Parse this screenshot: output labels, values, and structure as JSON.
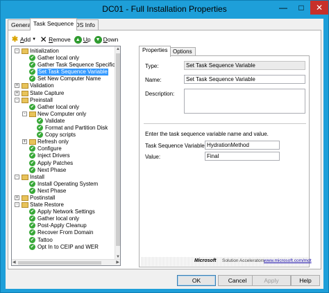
{
  "window": {
    "title": "DC01 - Full Installation Properties",
    "min": "—",
    "max": "□",
    "close": "✕"
  },
  "outer_tabs": [
    "General",
    "Task Sequence",
    "OS Info"
  ],
  "toolbar": {
    "add": "Add",
    "remove": "Remove",
    "up": "Up",
    "down": "Down"
  },
  "tree": [
    {
      "label": "Initialization",
      "level": 0,
      "type": "folder",
      "exp": "-"
    },
    {
      "label": "Gather local only",
      "level": 1,
      "type": "check"
    },
    {
      "label": "Gather Task Sequence Specific Settin",
      "level": 1,
      "type": "check"
    },
    {
      "label": "Set Task Sequence Variable",
      "level": 1,
      "type": "check",
      "selected": true
    },
    {
      "label": "Set New Computer Name",
      "level": 1,
      "type": "check"
    },
    {
      "label": "Validation",
      "level": 0,
      "type": "folder",
      "exp": "+"
    },
    {
      "label": "State Capture",
      "level": 0,
      "type": "folder",
      "exp": "+"
    },
    {
      "label": "Preinstall",
      "level": 0,
      "type": "folder",
      "exp": "-"
    },
    {
      "label": "Gather local only",
      "level": 1,
      "type": "check"
    },
    {
      "label": "New Computer only",
      "level": 1,
      "type": "folder",
      "exp": "-"
    },
    {
      "label": "Validate",
      "level": 2,
      "type": "check"
    },
    {
      "label": "Format and Partition Disk",
      "level": 2,
      "type": "check"
    },
    {
      "label": "Copy scripts",
      "level": 2,
      "type": "check"
    },
    {
      "label": "Refresh only",
      "level": 1,
      "type": "folder",
      "exp": "+"
    },
    {
      "label": "Configure",
      "level": 1,
      "type": "check"
    },
    {
      "label": "Inject Drivers",
      "level": 1,
      "type": "check"
    },
    {
      "label": "Apply Patches",
      "level": 1,
      "type": "check"
    },
    {
      "label": "Next Phase",
      "level": 1,
      "type": "check"
    },
    {
      "label": "Install",
      "level": 0,
      "type": "folder",
      "exp": "-"
    },
    {
      "label": "Install Operating System",
      "level": 1,
      "type": "check"
    },
    {
      "label": "Next Phase",
      "level": 1,
      "type": "check"
    },
    {
      "label": "Postinstall",
      "level": 0,
      "type": "folder",
      "exp": "+"
    },
    {
      "label": "State Restore",
      "level": 0,
      "type": "folder",
      "exp": "-"
    },
    {
      "label": "Apply Network Settings",
      "level": 1,
      "type": "check"
    },
    {
      "label": "Gather local only",
      "level": 1,
      "type": "check"
    },
    {
      "label": "Post-Apply Cleanup",
      "level": 1,
      "type": "check"
    },
    {
      "label": "Recover From Domain",
      "level": 1,
      "type": "check"
    },
    {
      "label": "Tattoo",
      "level": 1,
      "type": "check"
    },
    {
      "label": "Opt In to CEIP and WER",
      "level": 1,
      "type": "check"
    }
  ],
  "inner_tabs": [
    "Properties",
    "Options"
  ],
  "properties": {
    "type_label": "Type:",
    "type_value": "Set Task Sequence Variable",
    "name_label": "Name:",
    "name_value": "Set Task Sequence Variable",
    "description_label": "Description:",
    "description_value": "",
    "instruction": "Enter the task sequence variable name and value.",
    "tsv_label": "Task Sequence Variable:",
    "tsv_value": "HydrationMethod",
    "value_label": "Value:",
    "value_value": "Final"
  },
  "footer": {
    "microsoft": "Microsoft",
    "solution": "Solution Accelerators",
    "link": "www.microsoft.com/mdt"
  },
  "buttons": {
    "ok": "OK",
    "cancel": "Cancel",
    "apply": "Apply",
    "help": "Help"
  }
}
